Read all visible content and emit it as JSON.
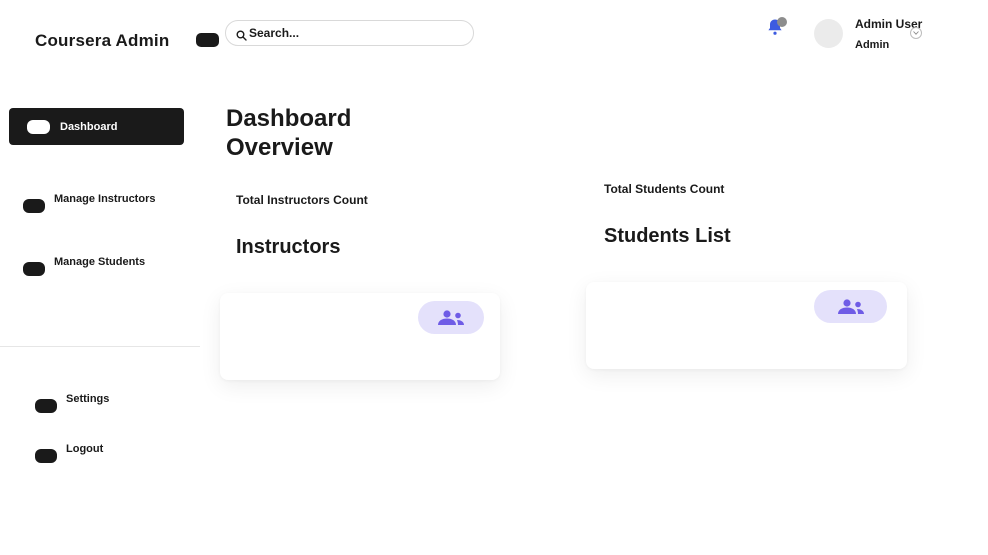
{
  "header": {
    "logo": "Coursera Admin",
    "search": {
      "placeholder": "Search...",
      "value": "Search..."
    },
    "notification_dot": "#8d8d8d",
    "user": {
      "name": "Admin User",
      "role": "Admin"
    }
  },
  "sidebar": {
    "active_item": {
      "label": "Dashboard"
    },
    "items": [
      {
        "label": "Manage Instructors"
      },
      {
        "label": "Manage Students"
      }
    ],
    "bottom_items": [
      {
        "label": "Settings"
      },
      {
        "label": "Logout"
      }
    ]
  },
  "main": {
    "title": "Dashboard Overview",
    "stats": [
      {
        "label": "Total Instructors Count",
        "value": "Instructors",
        "badge_icon": "users-icon"
      },
      {
        "label": "Total Students Count",
        "value": "Students List",
        "badge_icon": "users-icon"
      }
    ]
  },
  "colors": {
    "dark": "#1a1a1a",
    "badge_bg": "#e4e1fb",
    "badge_icon": "#6f5ce6",
    "bell": "#3d5be0"
  }
}
